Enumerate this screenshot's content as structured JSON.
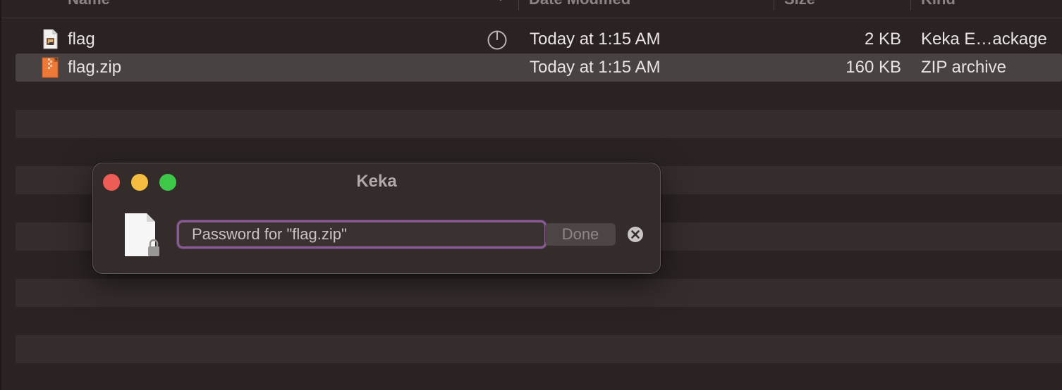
{
  "header": {
    "columns": [
      "Name",
      "Date Modified",
      "Size",
      "Kind"
    ]
  },
  "files": [
    {
      "name": "flag",
      "date": "Today at 1:15 AM",
      "size": "2 KB",
      "kind": "Keka E…ackage",
      "icon": "package-document-icon",
      "status_icon": "progress-icon"
    },
    {
      "name": "flag.zip",
      "date": "Today at 1:15 AM",
      "size": "160 KB",
      "kind": "ZIP archive",
      "icon": "zip-archive-icon",
      "selected": true
    }
  ],
  "dialog": {
    "title": "Keka",
    "password_placeholder": "Password for \"flag.zip\"",
    "password_value": "",
    "done_label": "Done",
    "icon": "locked-document-icon"
  },
  "colors": {
    "background": "#2b2323",
    "stripe": "#352d2c",
    "selection": "#494242",
    "focus_ring": "#8a5c93",
    "traffic_close": "#ee5d55",
    "traffic_minimize": "#f5bd3f",
    "traffic_maximize": "#3ec84a"
  }
}
